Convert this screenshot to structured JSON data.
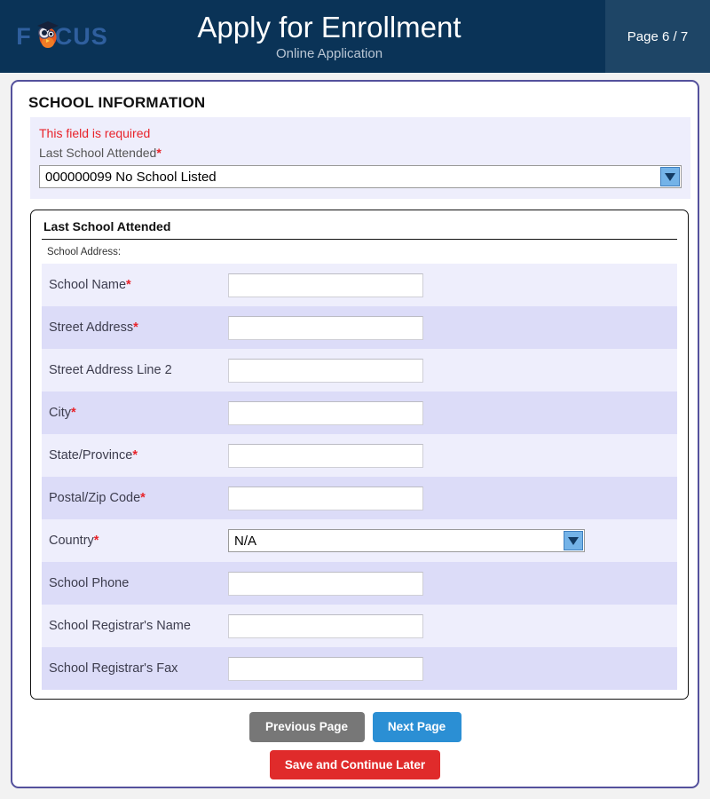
{
  "header": {
    "logo_text_left": "F",
    "logo_text_right": "CUS",
    "logo_icon": "owl-mascot-graduation-cap-icon",
    "title": "Apply for Enrollment",
    "subtitle": "Online Application",
    "page_indicator": "Page 6 / 7",
    "colors": {
      "header_bg": "#0a3357",
      "page_panel_bg": "#1e4566",
      "logo_blue": "#2f5f9e"
    }
  },
  "section": {
    "heading": "SCHOOL INFORMATION",
    "error_message": "This field is required",
    "last_school_label": "Last School Attended",
    "last_school_required_mark": "*",
    "last_school_value": "000000099 No School Listed"
  },
  "fieldset": {
    "title": "Last School Attended",
    "subtitle": "School Address:",
    "rows": [
      {
        "label": "School Name",
        "required": "*",
        "type": "text",
        "value": ""
      },
      {
        "label": "Street Address",
        "required": "*",
        "type": "text",
        "value": ""
      },
      {
        "label": "Street Address Line 2",
        "required": "",
        "type": "text",
        "value": ""
      },
      {
        "label": "City",
        "required": "*",
        "type": "text",
        "value": ""
      },
      {
        "label": "State/Province",
        "required": "*",
        "type": "text",
        "value": ""
      },
      {
        "label": "Postal/Zip Code",
        "required": "*",
        "type": "text",
        "value": ""
      },
      {
        "label": "Country",
        "required": "*",
        "type": "select",
        "value": "N/A"
      },
      {
        "label": "School Phone",
        "required": "",
        "type": "text",
        "value": ""
      },
      {
        "label": "School Registrar's Name",
        "required": "",
        "type": "text",
        "value": ""
      },
      {
        "label": "School Registrar's Fax",
        "required": "",
        "type": "text",
        "value": ""
      }
    ]
  },
  "buttons": {
    "previous": "Previous Page",
    "next": "Next Page",
    "save": "Save and Continue Later",
    "colors": {
      "previous": "#777777",
      "next": "#2b8fd4",
      "save": "#e02b2b"
    }
  },
  "theme": {
    "required_red": "#e8232a",
    "row_odd_bg": "#eeeefc",
    "row_even_bg": "#dcdcf8",
    "card_border": "#54519c"
  }
}
